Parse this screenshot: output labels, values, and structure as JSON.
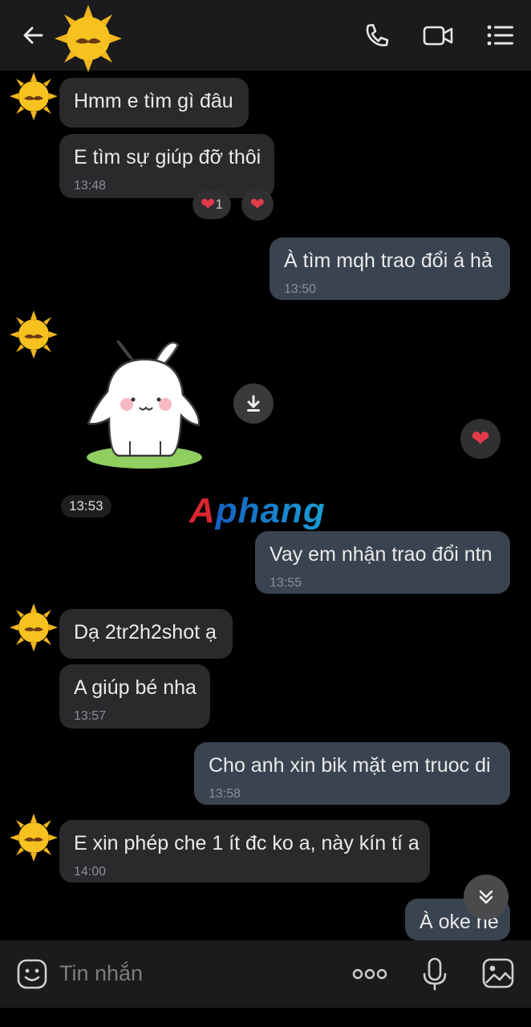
{
  "colors": {
    "background": "#000000",
    "incoming_bubble": "#2a2a2c",
    "outgoing_bubble": "#3a4350",
    "heart": "#e23b4b"
  },
  "header": {
    "back_icon": "arrow-left-icon",
    "call_icon": "phone-icon",
    "video_icon": "video-camera-icon",
    "menu_icon": "list-menu-icon",
    "avatar_icon": "sun-mustache-avatar"
  },
  "messages": [
    {
      "id": "m1",
      "dir": "in",
      "text": "Hmm e tìm gì đâu",
      "time": ""
    },
    {
      "id": "m2",
      "dir": "in",
      "text": "E tìm sự giúp đỡ thôi",
      "time": "13:48",
      "reactions": [
        "❤1",
        "❤"
      ]
    },
    {
      "id": "m3",
      "dir": "out",
      "text": "À tìm mqh trao đổi á hả",
      "time": "13:50"
    },
    {
      "id": "m4",
      "dir": "in",
      "type": "sticker",
      "sticker": "white-bunny-sticker",
      "time": "13:53",
      "reaction": "❤"
    },
    {
      "id": "m5",
      "dir": "out",
      "text": "Vay em nhận trao đổi ntn",
      "time": "13:55"
    },
    {
      "id": "m6",
      "dir": "in",
      "text": "Dạ 2tr2h2shot ạ",
      "time": ""
    },
    {
      "id": "m7",
      "dir": "in",
      "text": "A giúp bé nha",
      "time": "13:57"
    },
    {
      "id": "m8",
      "dir": "out",
      "text": "Cho anh xin bik mặt em truoc di",
      "time": "13:58"
    },
    {
      "id": "m9",
      "dir": "in",
      "text": "E xin phép che 1 ít đc ko a, này kín tí a",
      "time": "14:00"
    },
    {
      "id": "m10",
      "dir": "out",
      "text": "À oke ne",
      "time": ""
    }
  ],
  "watermark": "Aphang",
  "composer": {
    "placeholder": "Tin nhắn",
    "sticker_icon": "smiley-sticker-icon",
    "more_icon": "more-dots-icon",
    "mic_icon": "microphone-icon",
    "image_icon": "image-icon"
  }
}
